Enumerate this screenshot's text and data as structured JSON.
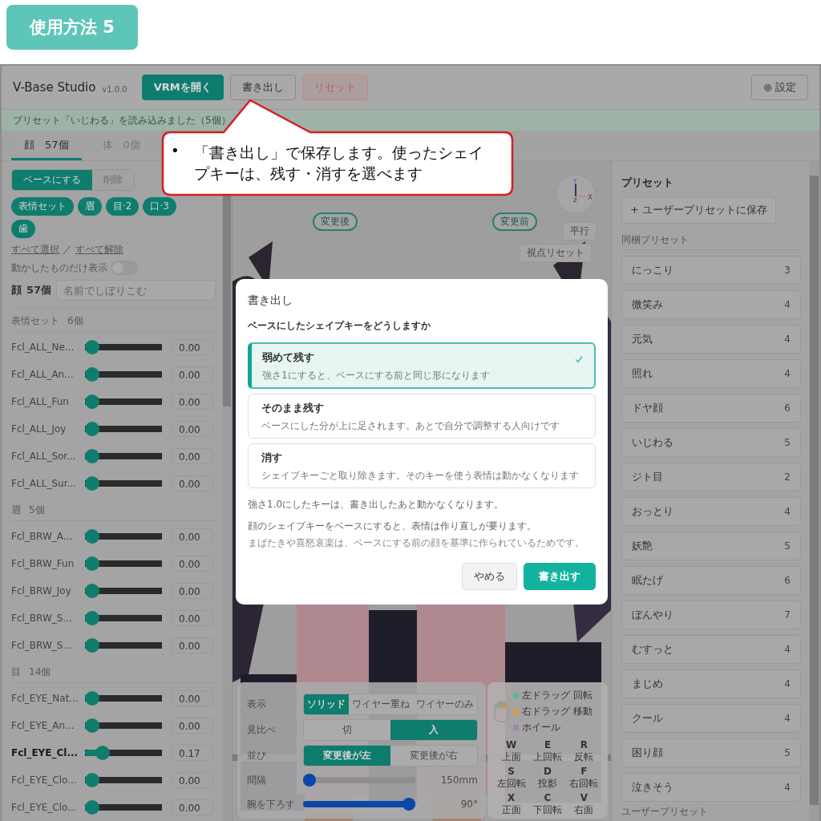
{
  "header_badge": {
    "label": "使用方法 5"
  },
  "app": {
    "title": "V-Base Studio",
    "version": "v1.0.0",
    "toolbar": [
      {
        "label": "VRMを開く",
        "kind": "primary"
      },
      {
        "label": "書き出し",
        "kind": "default"
      },
      {
        "label": "リセット",
        "kind": "danger"
      }
    ],
    "settings_button": {
      "label": "設定"
    },
    "status_message": "プリセット「いじわる」を読み込みました（5個）",
    "tabs": [
      {
        "name": "顔",
        "count": "57個",
        "selected": true
      },
      {
        "name": "体",
        "count": "0個",
        "selected": false
      }
    ]
  },
  "left_panel": {
    "mode_toggle": [
      {
        "label": "ベースにする",
        "selected": true
      },
      {
        "label": "削除",
        "selected": false
      }
    ],
    "category_chips": [
      {
        "label": "表情セット",
        "selected": true
      },
      {
        "label": "眉",
        "selected": true
      },
      {
        "label": "目·2",
        "selected": true
      },
      {
        "label": "口·3",
        "selected": true
      },
      {
        "label": "歯",
        "selected": true
      }
    ],
    "select_all": "すべて選択",
    "separator": "／",
    "deselect_all": "すべて解除",
    "moved_only": {
      "label": "動かしたものだけ表示",
      "on": false
    },
    "filter": {
      "label": "顔",
      "count": "57個",
      "placeholder": "名前でしぼりこむ"
    },
    "groups": [
      {
        "name": "表情セット",
        "count": "6個",
        "rows": [
          {
            "name": "Fcl_ALL_Ne...",
            "level": 0,
            "value": "0.00",
            "modified": false
          },
          {
            "name": "Fcl_ALL_An...",
            "level": 0,
            "value": "0.00",
            "modified": false
          },
          {
            "name": "Fcl_ALL_Fun",
            "level": 0,
            "value": "0.00",
            "modified": false
          },
          {
            "name": "Fcl_ALL_Joy",
            "level": 0,
            "value": "0.00",
            "modified": false
          },
          {
            "name": "Fcl_ALL_Sor...",
            "level": 0,
            "value": "0.00",
            "modified": false
          },
          {
            "name": "Fcl_ALL_Sur...",
            "level": 0,
            "value": "0.00",
            "modified": false
          }
        ]
      },
      {
        "name": "眉",
        "count": "5個",
        "rows": [
          {
            "name": "Fcl_BRW_A...",
            "level": 0,
            "value": "0.00",
            "modified": false
          },
          {
            "name": "Fcl_BRW_Fun",
            "level": 0,
            "value": "0.00",
            "modified": false
          },
          {
            "name": "Fcl_BRW_Joy",
            "level": 0,
            "value": "0.00",
            "modified": false
          },
          {
            "name": "Fcl_BRW_S...",
            "level": 0,
            "value": "0.00",
            "modified": false
          },
          {
            "name": "Fcl_BRW_S...",
            "level": 0,
            "value": "0.00",
            "modified": false
          }
        ]
      },
      {
        "name": "目",
        "count": "14個",
        "rows": [
          {
            "name": "Fcl_EYE_Nat...",
            "level": 0,
            "value": "0.00",
            "modified": false
          },
          {
            "name": "Fcl_EYE_An...",
            "level": 0,
            "value": "0.00",
            "modified": false
          },
          {
            "name": "Fcl_EYE_Cl...",
            "level": 0.17,
            "value": "0.17",
            "modified": true
          },
          {
            "name": "Fcl_EYE_Clo...",
            "level": 0,
            "value": "0.00",
            "modified": false
          },
          {
            "name": "Fcl_EYE_Clo...",
            "level": 0,
            "value": "0.00",
            "modified": false
          }
        ]
      }
    ]
  },
  "viewport": {
    "compare_labels": [
      {
        "label": "変更後"
      },
      {
        "label": "変更前"
      }
    ],
    "axis_gizmo": {
      "axes": [
        "Y",
        "Z",
        "X"
      ]
    },
    "projection_button": "平行",
    "reset_view_button": "視点リセット",
    "display_panel": [
      {
        "label": "表示",
        "kind": "segmented",
        "options": [
          {
            "label": "ソリッド",
            "selected": true
          },
          {
            "label": "ワイヤー重ね",
            "selected": false
          },
          {
            "label": "ワイヤーのみ",
            "selected": false
          }
        ]
      },
      {
        "label": "見比べ",
        "kind": "segmented",
        "options": [
          {
            "label": "切",
            "selected": false
          },
          {
            "label": "入",
            "selected": true
          }
        ]
      },
      {
        "label": "並び",
        "kind": "segmented",
        "options": [
          {
            "label": "変更後が左",
            "selected": true
          },
          {
            "label": "変更後が右",
            "selected": false
          }
        ]
      },
      {
        "label": "間隔",
        "kind": "slider",
        "level": 0,
        "reading": "150mm"
      },
      {
        "label": "腕を下ろす",
        "kind": "slider",
        "level": 1,
        "reading": "90°"
      }
    ],
    "mouse_legend": [
      {
        "label": "左ドラッグ 回転",
        "color": "#5fb88a"
      },
      {
        "label": "右ドラッグ 移動",
        "color": "#d99a4a"
      },
      {
        "label": "ホイール",
        "color": "#9a8aa6"
      }
    ],
    "keys": [
      {
        "key": "W",
        "action": "上面"
      },
      {
        "key": "E",
        "action": "上回転"
      },
      {
        "key": "R",
        "action": "反転"
      },
      {
        "key": "S",
        "action": "左回転"
      },
      {
        "key": "D",
        "action": "投影"
      },
      {
        "key": "F",
        "action": "右回転"
      },
      {
        "key": "X",
        "action": "正面"
      },
      {
        "key": "C",
        "action": "下回転"
      },
      {
        "key": "V",
        "action": "右面"
      }
    ]
  },
  "dialog": {
    "title": "書き出し",
    "question": "ベースにしたシェイプキーをどうしますか",
    "options": [
      {
        "title": "弱めて残す",
        "description": "強さ1にすると、ベースにする前と同じ形になります",
        "selected": true
      },
      {
        "title": "そのまま残す",
        "description": "ベースにした分が上に足されます。あとで自分で調整する人向けです",
        "selected": false
      },
      {
        "title": "消す",
        "description": "シェイプキーごと取り除きます。そのキーを使う表情は動かなくなります",
        "selected": false
      }
    ],
    "notes": [
      "強さ1.0にしたキーは、書き出したあと動かなくなります。",
      "顔のシェイプキーをベースにすると、表情は作り直しが要ります。",
      "まばたきや喜怒哀楽は、ベースにする前の顔を基準に作られているためです。"
    ],
    "buttons": [
      {
        "label": "やめる",
        "kind": "secondary"
      },
      {
        "label": "書き出す",
        "kind": "primary"
      }
    ]
  },
  "callout": {
    "bullet": "•",
    "text": "「書き出し」で保存します。使ったシェイプキーは、残す・消すを選べます"
  },
  "right_panel": {
    "title": "プリセット",
    "save_button": "+ ユーザープリセットに保存",
    "bundled_heading": "同梱プリセット",
    "presets": [
      {
        "name": "にっこり",
        "count": "3"
      },
      {
        "name": "微笑み",
        "count": "4"
      },
      {
        "name": "元気",
        "count": "4"
      },
      {
        "name": "照れ",
        "count": "4"
      },
      {
        "name": "ドヤ顔",
        "count": "6"
      },
      {
        "name": "いじわる",
        "count": "5"
      },
      {
        "name": "ジト目",
        "count": "2"
      },
      {
        "name": "おっとり",
        "count": "4"
      },
      {
        "name": "妖艶",
        "count": "5"
      },
      {
        "name": "眠たげ",
        "count": "6"
      },
      {
        "name": "ぼんやり",
        "count": "7"
      },
      {
        "name": "むすっと",
        "count": "4"
      },
      {
        "name": "まじめ",
        "count": "4"
      },
      {
        "name": "クール",
        "count": "4"
      },
      {
        "name": "困り顔",
        "count": "5"
      },
      {
        "name": "泣きそう",
        "count": "4"
      }
    ],
    "user_heading": "ユーザープリセット"
  }
}
